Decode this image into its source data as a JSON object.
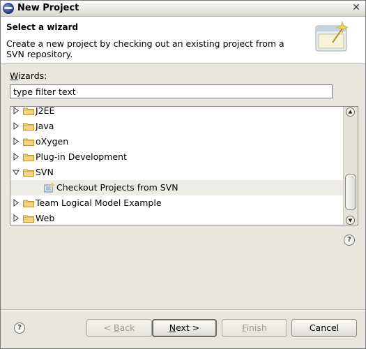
{
  "window": {
    "title": "New Project",
    "close_glyph": "✕"
  },
  "banner": {
    "title": "Select a wizard",
    "description": "Create a new project by checking out an existing project from a SVN repository.",
    "image_icon": "wizard-banner-icon"
  },
  "wizards": {
    "label_mnemonic": "W",
    "label_rest": "izards:",
    "filter_value": "type filter text",
    "tree": [
      {
        "label": "J2EE",
        "expanded": false,
        "icon": "folder-icon"
      },
      {
        "label": "Java",
        "expanded": false,
        "icon": "folder-icon"
      },
      {
        "label": "oXygen",
        "expanded": false,
        "icon": "folder-icon"
      },
      {
        "label": "Plug-in Development",
        "expanded": false,
        "icon": "folder-icon"
      },
      {
        "label": "SVN",
        "expanded": true,
        "icon": "folder-icon"
      },
      {
        "label": "Checkout Projects from SVN",
        "child": true,
        "selected": true,
        "icon": "svn-checkout-icon"
      },
      {
        "label": "Team Logical Model Example",
        "expanded": false,
        "icon": "folder-icon"
      },
      {
        "label": "Web",
        "expanded": false,
        "icon": "folder-icon"
      }
    ]
  },
  "help": {
    "glyph": "?"
  },
  "buttons": {
    "back_mnemonic": "B",
    "back_prefix": "< ",
    "back_rest": "ack",
    "next_mnemonic": "N",
    "next_rest": "ext >",
    "finish_mnemonic": "F",
    "finish_rest": "inish",
    "cancel_label": "Cancel"
  }
}
